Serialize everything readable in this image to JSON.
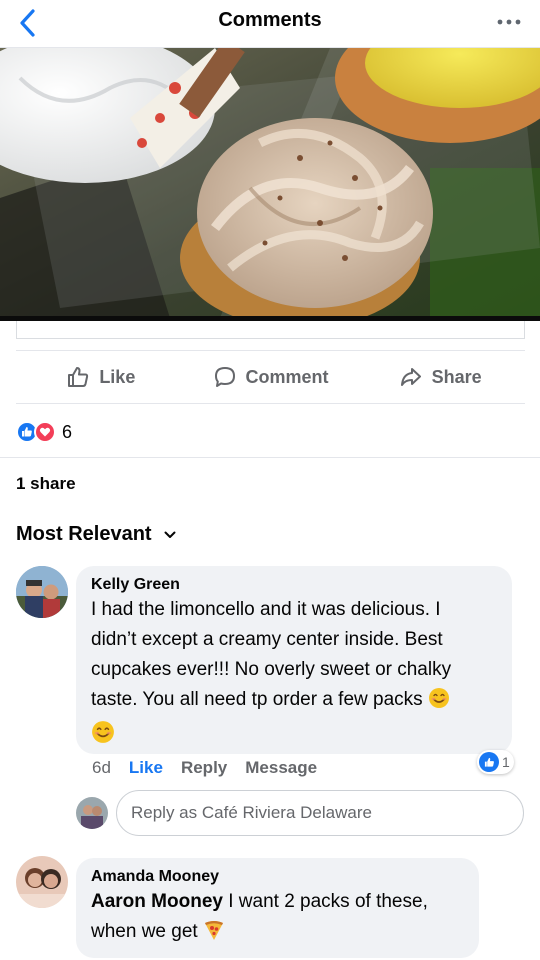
{
  "header": {
    "title": "Comments",
    "back_icon": "chevron-left-icon",
    "more_icon": "more-horizontal-icon",
    "accent": "#1877f2"
  },
  "post": {
    "actions": [
      {
        "label": "Like",
        "icon": "thumbs-up-icon"
      },
      {
        "label": "Comment",
        "icon": "comment-icon"
      },
      {
        "label": "Share",
        "icon": "share-icon"
      }
    ],
    "reaction_count": "6",
    "shares_text": "1 share"
  },
  "comments_sort": {
    "label": "Most Relevant",
    "icon": "chevron-down-icon"
  },
  "comments": [
    {
      "author": "Kelly Green",
      "lines": [
        "I had the limoncello and it was delicious. I",
        "didn’t except a creamy center inside. Best",
        "cupcakes ever!!! No overly sweet or chalky",
        "taste. You all need tp order a few packs",
        "😊"
      ],
      "time": "6d",
      "like_label": "Like",
      "reply_label": "Reply",
      "message_label": "Message",
      "reaction_count": "1"
    },
    {
      "author": "Amanda Mooney",
      "tagged": "Aaron Mooney",
      "line1_rest": " I want 2 packs of these,",
      "line2": "when we get"
    }
  ],
  "reply_input": {
    "placeholder": "Reply as Café Riviera Delaware"
  }
}
